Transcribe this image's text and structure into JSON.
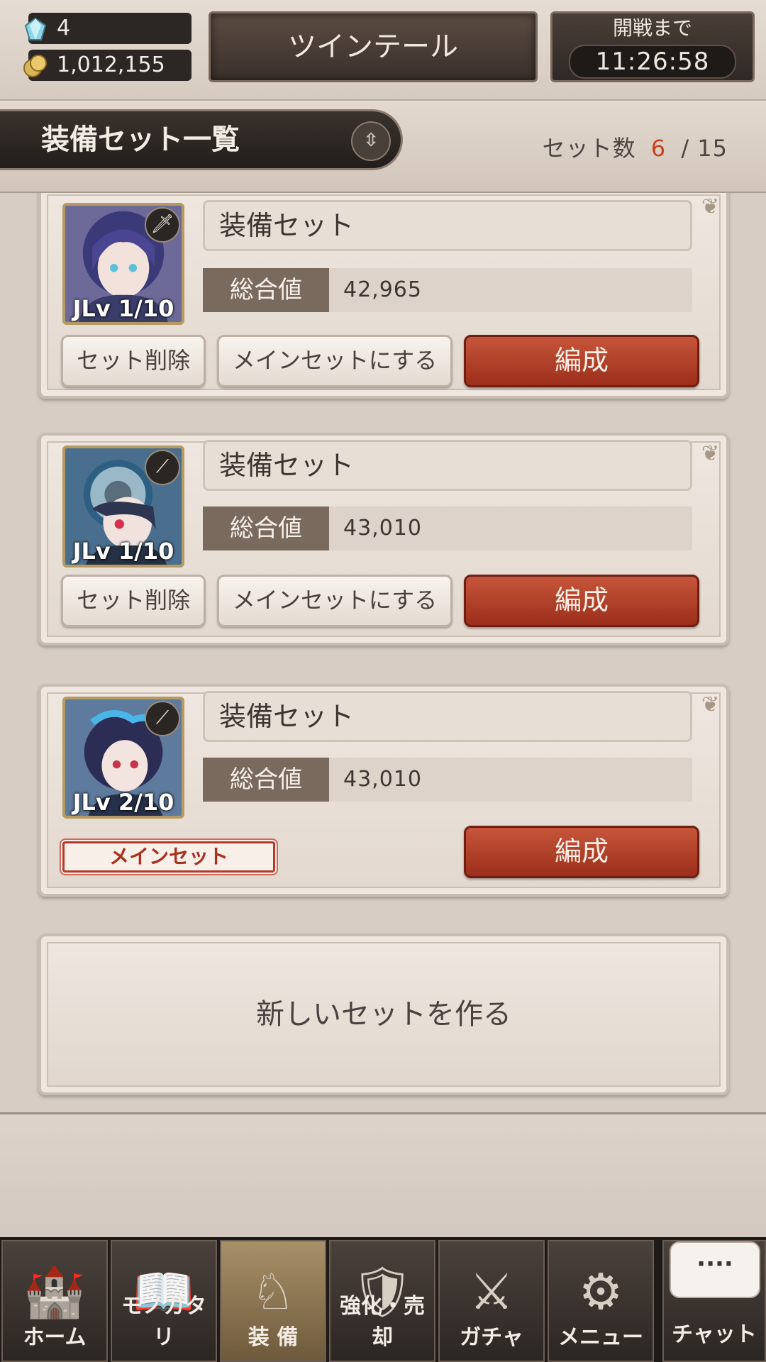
{
  "status": {
    "gems": "4",
    "gold": "1,012,155",
    "title": "ツインテール",
    "timer_label": "開戦まで",
    "timer_value": "11:26:58"
  },
  "header": {
    "title": "装備セット一覧",
    "count_label": "セット数",
    "count_current": "6",
    "count_separator": "/",
    "count_max": "15"
  },
  "sets": [
    {
      "name": "装備セット",
      "stat_label": "総合値",
      "stat_value": "42,965",
      "level": "JLv 1/10",
      "delete_label": "セット削除",
      "make_main_label": "メインセットにする",
      "form_label": "編成"
    },
    {
      "name": "装備セット",
      "stat_label": "総合値",
      "stat_value": "43,010",
      "level": "JLv 1/10",
      "delete_label": "セット削除",
      "make_main_label": "メインセットにする",
      "form_label": "編成"
    },
    {
      "name": "装備セット",
      "stat_label": "総合値",
      "stat_value": "43,010",
      "level": "JLv 2/10",
      "main_badge": "メインセット",
      "form_label": "編成"
    }
  ],
  "new_set_label": "新しいセットを作る",
  "nav": {
    "items": [
      {
        "label": "ホーム",
        "icon": "castle-icon"
      },
      {
        "label": "モノガタリ",
        "icon": "book-icon"
      },
      {
        "label": "装 備",
        "icon": "puppet-icon"
      },
      {
        "label": "強化・売却",
        "icon": "shield-icon"
      },
      {
        "label": "ガチャ",
        "icon": "swords-icon"
      },
      {
        "label": "メニュー",
        "icon": "gears-icon"
      }
    ],
    "chat_label": "チャット",
    "chat_bubble": "····"
  },
  "colors": {
    "accent_red": "#9c2f1b",
    "count_highlight": "#c8401e",
    "dark_panel": "#2c2725"
  }
}
